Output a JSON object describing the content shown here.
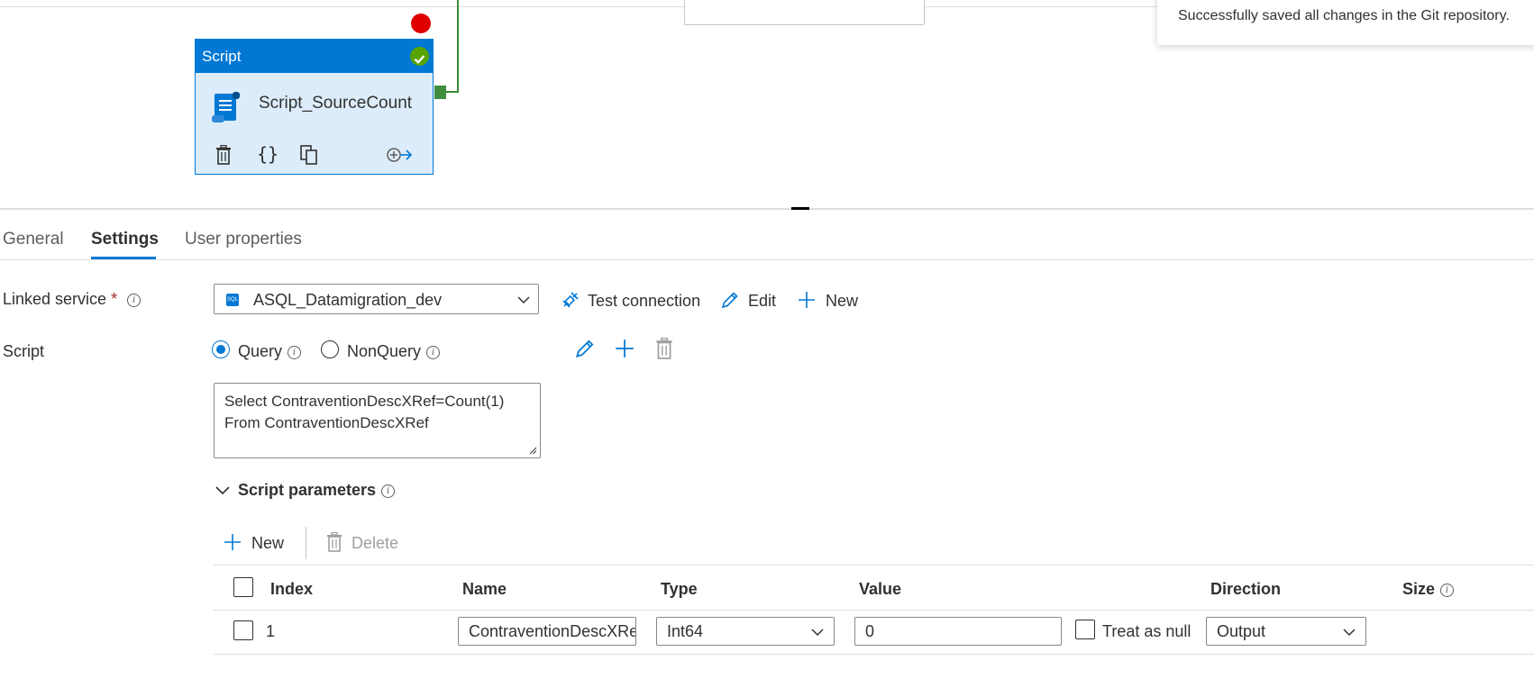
{
  "toast": {
    "message": "Successfully saved all changes in the Git repository."
  },
  "activity": {
    "type_label": "Script",
    "name": "Script_SourceCount"
  },
  "tabs": [
    {
      "label": "General"
    },
    {
      "label": "Settings"
    },
    {
      "label": "User properties"
    }
  ],
  "linked_service": {
    "label": "Linked service",
    "required_mark": "*",
    "value": "ASQL_Datamigration_dev",
    "icon_text": "SQL",
    "actions": {
      "test_connection": "Test connection",
      "edit": "Edit",
      "new": "New"
    }
  },
  "script": {
    "label": "Script",
    "options": {
      "query": "Query",
      "nonquery": "NonQuery"
    },
    "selected": "Query",
    "lines": [
      "Select ContraventionDescXRef=Count(1)",
      "From ContraventionDescXRef"
    ]
  },
  "script_parameters": {
    "title": "Script parameters",
    "toolbar": {
      "new": "New",
      "delete": "Delete"
    },
    "columns": [
      "Index",
      "Name",
      "Type",
      "Value",
      "Direction",
      "Size"
    ],
    "rows": [
      {
        "index": "1",
        "name": "ContraventionDescXRef",
        "type": "Int64",
        "value": "0",
        "treat_as_null": "Treat as null",
        "direction": "Output"
      }
    ]
  },
  "colors": {
    "accent": "#0078d4",
    "success": "#57a300",
    "error_dot": "#e00000",
    "required": "#a4262c"
  }
}
